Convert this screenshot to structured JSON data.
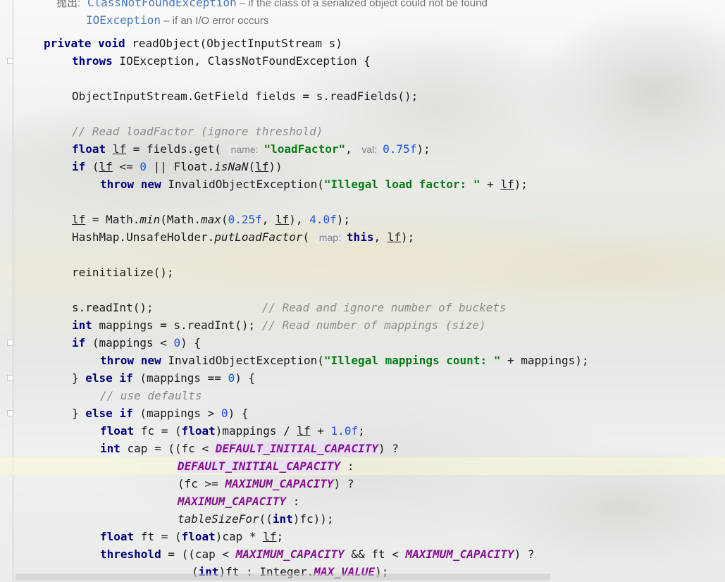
{
  "doc": {
    "throws_label": "抛出:",
    "ex1": "ClassNotFoundException",
    "ex1_desc": " – if the class of a serialized object could not be found",
    "ex2": "IOException",
    "ex2_desc": " – if an I/O error occurs"
  },
  "hints": {
    "name": "name:",
    "val": "val:",
    "map": "map:"
  },
  "code": {
    "l1_kw": "private void",
    "l1_rest": " readObject(ObjectInputStream s)",
    "l2_kw": "throws",
    "l2_rest": " IOException, ClassNotFoundException {",
    "l3": "ObjectInputStream.GetField fields = s.readFields();",
    "l4_comment": "// Read loadFactor (ignore threshold)",
    "l5_kw": "float",
    "l5_var": "lf",
    "l5_mid": " = fields.get(",
    "l5_str": "\"loadFactor\"",
    "l5_num": "0.75f",
    "l6_kw": "if",
    "l6_num": "0",
    "l6_call": "isNaN",
    "l7_kw": "throw new",
    "l7_cls": " InvalidObjectException(",
    "l7_str": "\"Illegal load factor: \"",
    "l8_min": "min",
    "l8_max": "max",
    "l8_n1": "0.25f",
    "l8_n2": "4.0f",
    "l9_pre": "HashMap.UnsafeHolder.",
    "l9_call": "putLoadFactor",
    "l9_kw": "this",
    "l10": "reinitialize();",
    "l11_code": "s.readInt();",
    "l11_comment": "// Read and ignore number of buckets",
    "l12_kw": "int",
    "l12_code": " mappings = s.readInt(); ",
    "l12_comment": "// Read number of mappings (size)",
    "l13_kw": "if",
    "l13_num": "0",
    "l14_str": "\"Illegal mappings count: \"",
    "l15_kw": "else if",
    "l15_num": "0",
    "l16_comment": "// use defaults",
    "l17_num": "0",
    "l18_kw": "float",
    "l18_num": "1.0f",
    "l19_kw": "int",
    "c_default": "DEFAULT_INITIAL_CAPACITY",
    "c_max": "MAXIMUM_CAPACITY",
    "c_maxval": "MAX_VALUE",
    "l23_call": "tableSizeFor",
    "l25_var": "threshold"
  }
}
